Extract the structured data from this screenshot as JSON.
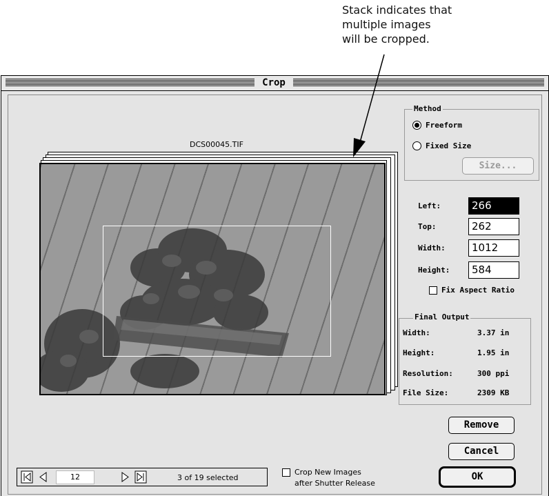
{
  "callout": {
    "line1": "Stack indicates that",
    "line2": "multiple images",
    "line3": "will be cropped."
  },
  "window": {
    "title": "Crop"
  },
  "preview": {
    "filename": "DCS00045.TIF"
  },
  "method": {
    "label": "Method",
    "freeform_label": "Freeform",
    "fixed_size_label": "Fixed Size",
    "size_button": "Size...",
    "selected": "Freeform"
  },
  "crop_fields": {
    "left_label": "Left:",
    "left_value": "266",
    "top_label": "Top:",
    "top_value": "262",
    "width_label": "Width:",
    "width_value": "1012",
    "height_label": "Height:",
    "height_value": "584",
    "fix_aspect_label": "Fix Aspect Ratio"
  },
  "final_output": {
    "label": "Final Output",
    "width_label": "Width:",
    "width_value": "3.37 in",
    "height_label": "Height:",
    "height_value": "1.95 in",
    "resolution_label": "Resolution:",
    "resolution_value": "300 ppi",
    "filesize_label": "File Size:",
    "filesize_value": "2309 KB"
  },
  "buttons": {
    "remove": "Remove",
    "cancel": "Cancel",
    "ok": "OK"
  },
  "navigation": {
    "page": "12",
    "selection_info": "3 of 19 selected"
  },
  "crop_new_images": {
    "line1": "Crop New Images",
    "line2": "after Shutter Release"
  }
}
